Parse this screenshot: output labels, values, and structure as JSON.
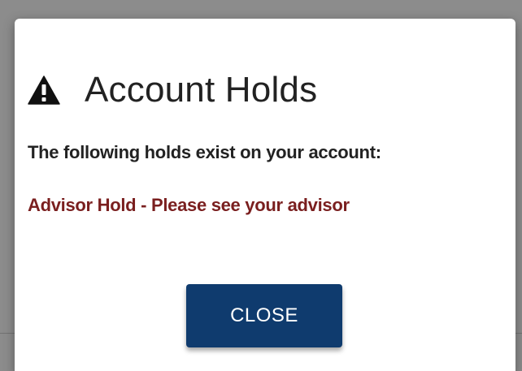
{
  "modal": {
    "title": "Account Holds",
    "icon": "warning-triangle-icon",
    "intro": "The following holds exist on your account:",
    "holds": [
      {
        "text": "Advisor Hold - Please see your advisor"
      }
    ],
    "close_label": "CLOSE"
  },
  "colors": {
    "button_bg": "#0f3b6e",
    "hold_text": "#7a1f1f",
    "overlay": "rgba(0,0,0,0.45)"
  }
}
